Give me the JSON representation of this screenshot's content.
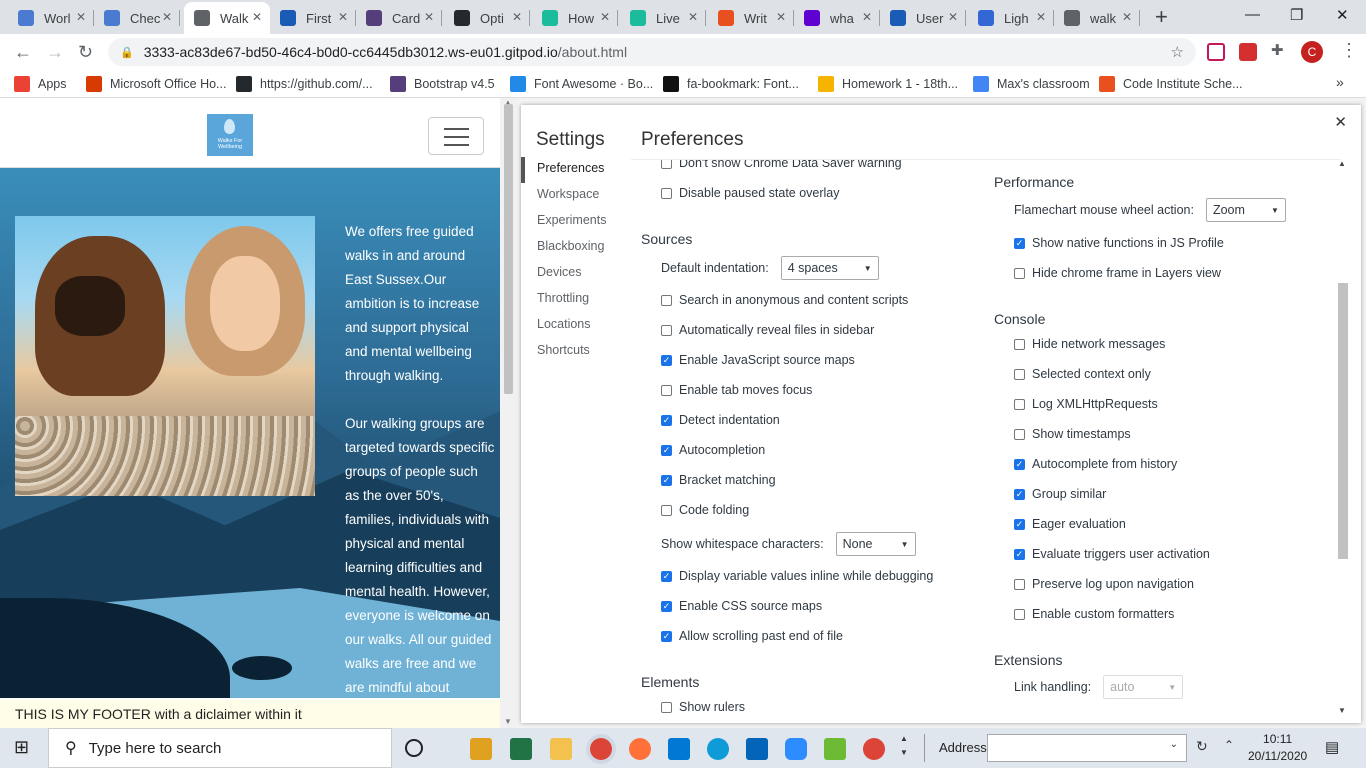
{
  "browser": {
    "tabs": [
      {
        "label": "Worl",
        "color": "#4a7bd0"
      },
      {
        "label": "Chec",
        "color": "#4a7bd0"
      },
      {
        "label": "Walk",
        "color": "#5f6368",
        "active": true
      },
      {
        "label": "First",
        "color": "#1a5bb5"
      },
      {
        "label": "Card",
        "color": "#563d7c"
      },
      {
        "label": "Opti",
        "color": "#24292e"
      },
      {
        "label": "How",
        "color": "#1abc9c"
      },
      {
        "label": "Live",
        "color": "#1abc9c"
      },
      {
        "label": "Writ",
        "color": "#e8511f"
      },
      {
        "label": "wha",
        "color": "#5f01d1"
      },
      {
        "label": "User",
        "color": "#1a5bb5"
      },
      {
        "label": "Ligh",
        "color": "#3367d6"
      },
      {
        "label": "walk",
        "color": "#5f6368"
      }
    ],
    "url_host": "3333-ac83de67-bd50-46c4-b0d0-cc6445db3012.ws-eu01.gitpod.io",
    "url_path": "/about.html",
    "profile_initial": "C",
    "bookmarks": [
      {
        "label": "Apps",
        "color": "#ea4335"
      },
      {
        "label": "Microsoft Office Ho...",
        "color": "#d83b01"
      },
      {
        "label": "https://github.com/...",
        "color": "#24292e"
      },
      {
        "label": "Bootstrap v4.5",
        "color": "#563d7c"
      },
      {
        "label": "Font Awesome · Bo...",
        "color": "#228ae6"
      },
      {
        "label": "fa-bookmark: Font...",
        "color": "#111111"
      },
      {
        "label": "Homework 1 - 18th...",
        "color": "#f4b400"
      },
      {
        "label": "Max's classroom",
        "color": "#4285f4"
      },
      {
        "label": "Code Institute Sche...",
        "color": "#e8511f"
      }
    ],
    "more": "»"
  },
  "site": {
    "logo_text": "Walks For Wellbeing",
    "paragraphs": [
      "We offers free guided walks in and around East Sussex.Our ambition is to increase and support physical and mental wellbeing through walking.",
      "Our walking groups are targeted towards specific groups of people such as the over 50's, families, individuals with physical and mental learning difficulties and mental health. However, everyone is welcome on our walks. All our guided walks are free and we are mindful about"
    ],
    "footer": "THIS IS MY FOOTER with a diclaimer within it"
  },
  "settings": {
    "title": "Settings",
    "page_title": "Preferences",
    "nav": [
      "Preferences",
      "Workspace",
      "Experiments",
      "Blackboxing",
      "Devices",
      "Throttling",
      "Locations",
      "Shortcuts"
    ],
    "left": {
      "top_items": [
        {
          "label": "Don't show Chrome Data Saver warning",
          "checked": false
        },
        {
          "label": "Disable paused state overlay",
          "checked": false
        }
      ],
      "sources_title": "Sources",
      "indent_label": "Default indentation:",
      "indent_value": "4 spaces",
      "sources_items": [
        {
          "label": "Search in anonymous and content scripts",
          "checked": false
        },
        {
          "label": "Automatically reveal files in sidebar",
          "checked": false
        },
        {
          "label": "Enable JavaScript source maps",
          "checked": true
        },
        {
          "label": "Enable tab moves focus",
          "checked": false
        },
        {
          "label": "Detect indentation",
          "checked": true
        },
        {
          "label": "Autocompletion",
          "checked": true
        },
        {
          "label": "Bracket matching",
          "checked": true
        },
        {
          "label": "Code folding",
          "checked": false
        }
      ],
      "whitespace_label": "Show whitespace characters:",
      "whitespace_value": "None",
      "sources_items2": [
        {
          "label": "Display variable values inline while debugging",
          "checked": true
        },
        {
          "label": "Enable CSS source maps",
          "checked": true
        },
        {
          "label": "Allow scrolling past end of file",
          "checked": true
        }
      ],
      "elements_title": "Elements",
      "elements_items": [
        {
          "label": "Show rulers",
          "checked": false
        }
      ]
    },
    "right": {
      "performance_title": "Performance",
      "flame_label": "Flamechart mouse wheel action:",
      "flame_value": "Zoom",
      "perf_items": [
        {
          "label": "Show native functions in JS Profile",
          "checked": true
        },
        {
          "label": "Hide chrome frame in Layers view",
          "checked": false
        }
      ],
      "console_title": "Console",
      "console_items": [
        {
          "label": "Hide network messages",
          "checked": false
        },
        {
          "label": "Selected context only",
          "checked": false
        },
        {
          "label": "Log XMLHttpRequests",
          "checked": false
        },
        {
          "label": "Show timestamps",
          "checked": false
        },
        {
          "label": "Autocomplete from history",
          "checked": true
        },
        {
          "label": "Group similar",
          "checked": true
        },
        {
          "label": "Eager evaluation",
          "checked": true
        },
        {
          "label": "Evaluate triggers user activation",
          "checked": true
        },
        {
          "label": "Preserve log upon navigation",
          "checked": false
        },
        {
          "label": "Enable custom formatters",
          "checked": false
        }
      ],
      "extensions_title": "Extensions",
      "link_label": "Link handling:",
      "link_value": "auto"
    }
  },
  "taskbar": {
    "search_placeholder": "Type here to search",
    "address_label": "Address",
    "time": "10:11",
    "date": "20/11/2020"
  }
}
